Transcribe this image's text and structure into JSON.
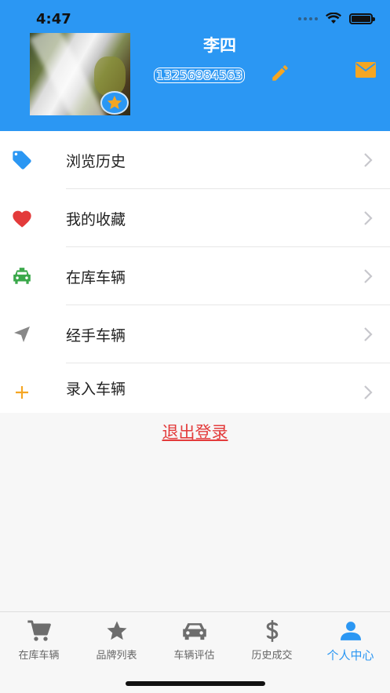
{
  "status_bar": {
    "time": "4:47"
  },
  "profile": {
    "name": "李四",
    "phone": "13256984563"
  },
  "menu": [
    {
      "label": "浏览历史",
      "icon": "tag-icon",
      "color": "#2b97f3"
    },
    {
      "label": "我的收藏",
      "icon": "heart-icon",
      "color": "#e33b3b"
    },
    {
      "label": "在库车辆",
      "icon": "taxi-icon",
      "color": "#3aa84a"
    },
    {
      "label": "经手车辆",
      "icon": "send-icon",
      "color": "#888888"
    },
    {
      "label": "录入车辆",
      "icon": "plus-icon",
      "color": "#f5a623"
    }
  ],
  "logout_label": "退出登录",
  "tabs": [
    {
      "label": "在库车辆",
      "icon": "cart-icon"
    },
    {
      "label": "品牌列表",
      "icon": "star-icon"
    },
    {
      "label": "车辆评估",
      "icon": "car-icon"
    },
    {
      "label": "历史成交",
      "icon": "dollar-icon"
    },
    {
      "label": "个人中心",
      "icon": "person-icon",
      "active": true
    }
  ],
  "colors": {
    "primary": "#2b97f3",
    "accent": "#f5a623",
    "danger": "#e33b3b"
  }
}
